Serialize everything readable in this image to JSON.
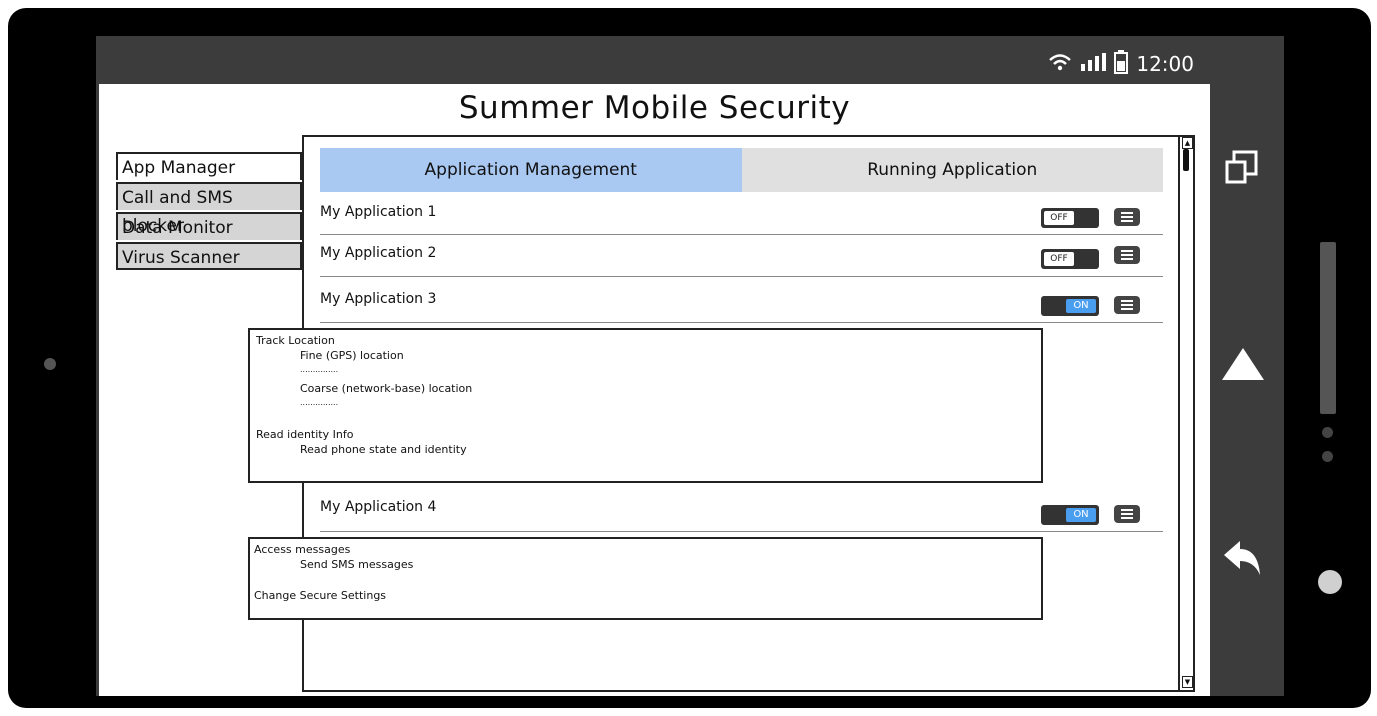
{
  "status_bar": {
    "time": "12:00",
    "icons": [
      "wifi-icon",
      "signal-icon",
      "battery-icon"
    ]
  },
  "app": {
    "title": "Summer Mobile Security"
  },
  "sidebar": {
    "items": [
      {
        "label": "App Manager",
        "active": true
      },
      {
        "label": "Call and SMS blocker",
        "active": false
      },
      {
        "label": "Data Monitor",
        "active": false
      },
      {
        "label": "Virus Scanner",
        "active": false
      }
    ]
  },
  "tabs": [
    {
      "label": "Application Management",
      "active": true
    },
    {
      "label": "Running Application",
      "active": false
    }
  ],
  "applications": [
    {
      "name": "My Application 1",
      "toggle": "OFF"
    },
    {
      "name": "My Application 2",
      "toggle": "OFF"
    },
    {
      "name": "My Application 3",
      "toggle": "ON"
    },
    {
      "name": "My Application 4",
      "toggle": "ON"
    }
  ],
  "permissions": {
    "app3": {
      "group1": "Track Location",
      "fine": "Fine (GPS) location",
      "dots1": "...............",
      "coarse": "Coarse (network-base) location",
      "dots2": "...............",
      "group2": "Read identity Info",
      "phone": "Read phone state and identity"
    },
    "app4": {
      "group1": "Access messages",
      "sms": "Send SMS messages",
      "group2": "Change Secure Settings"
    }
  },
  "colors": {
    "tab_active": "#a9c8f2",
    "tab_inactive": "#e0e0e0",
    "toggle_on": "#4a9ef0",
    "frame": "#000000",
    "bars": "#3c3c3c"
  },
  "nav_icons": [
    "recent-apps-icon",
    "home-icon",
    "back-icon"
  ]
}
